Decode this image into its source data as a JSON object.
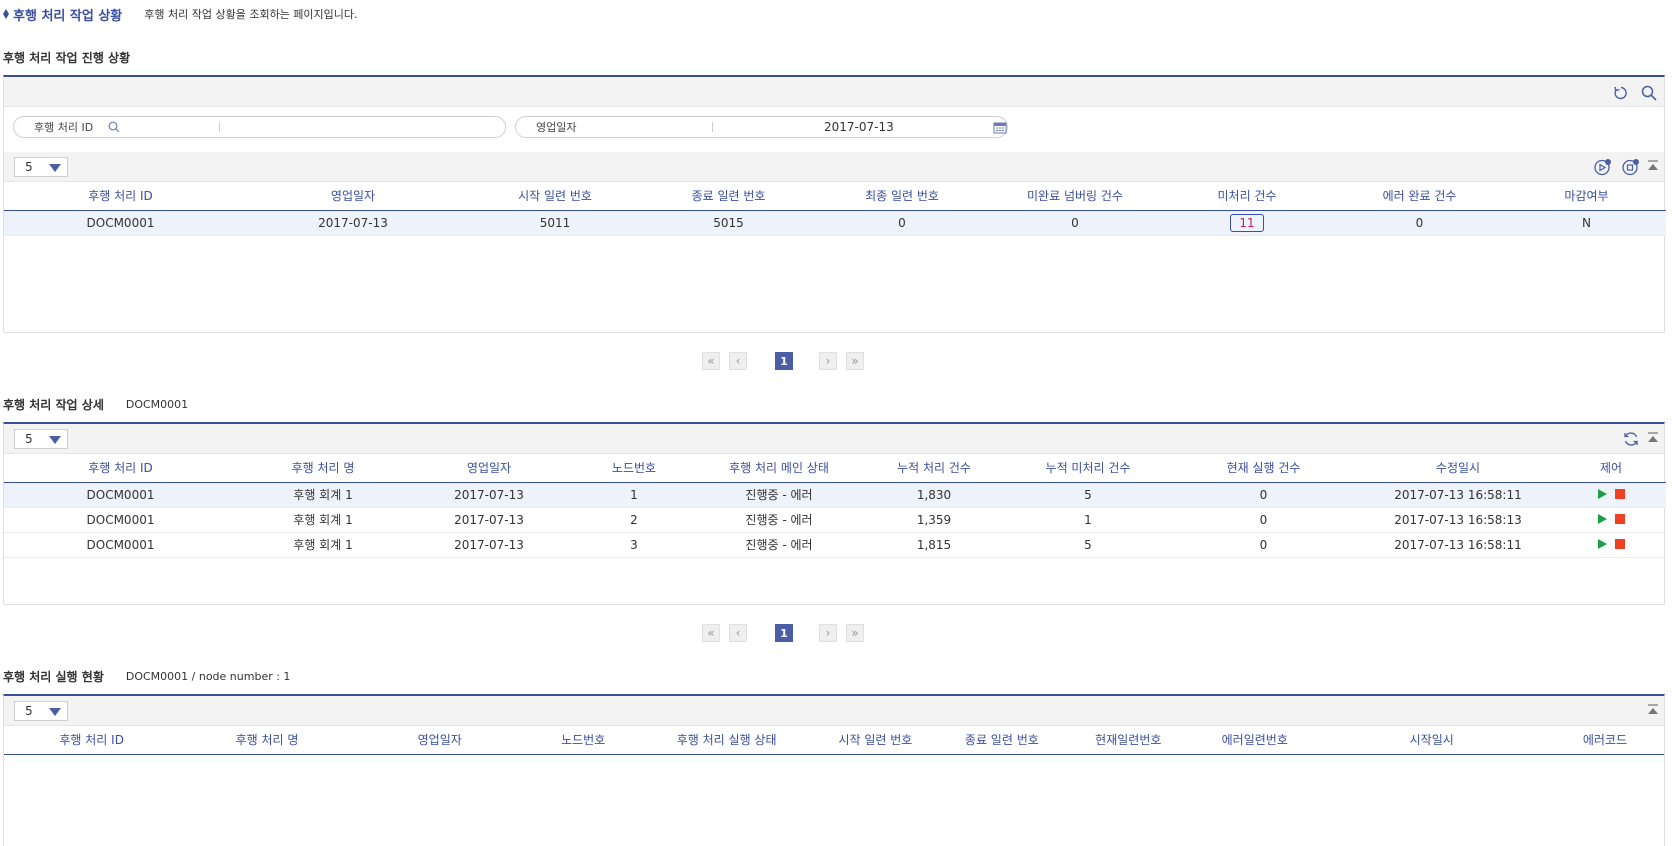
{
  "page": {
    "title": "후행 처리 작업 상황",
    "description": "후행 처리 작업 상황을 조회하는 페이지입니다."
  },
  "section1": {
    "title": "후행 처리 작업 진행 상황",
    "filters": {
      "id_label": "후행 처리 ID",
      "id_value": "",
      "date_label": "영업일자",
      "date_value": "2017-07-13"
    },
    "page_size": "5",
    "columns": [
      "후행 처리 ID",
      "영업일자",
      "시작 일련 번호",
      "종료 일련 번호",
      "최종 일련 번호",
      "미완료 넘버링 건수",
      "미처리 건수",
      "에러 완료 건수",
      "마감여부"
    ],
    "rows": [
      [
        "DOCM0001",
        "2017-07-13",
        "5011",
        "5015",
        "0",
        "0",
        "11",
        "0",
        "N"
      ]
    ],
    "pager": {
      "first": "«",
      "prev": "‹",
      "current": "1",
      "next": "›",
      "last": "»"
    }
  },
  "section2": {
    "title": "후행 처리 작업 상세",
    "subtitle": "DOCM0001",
    "page_size": "5",
    "columns": [
      "후행 처리 ID",
      "후행 처리 명",
      "영업일자",
      "노드번호",
      "후행 처리 메인 상태",
      "누적 처리 건수",
      "누적 미처리 건수",
      "현재 실행 건수",
      "수정일시",
      "제어"
    ],
    "rows": [
      [
        "DOCM0001",
        "후행 회계 1",
        "2017-07-13",
        "1",
        "진행중 - 에러",
        "1,830",
        "5",
        "0",
        "2017-07-13 16:58:11"
      ],
      [
        "DOCM0001",
        "후행 회계 1",
        "2017-07-13",
        "2",
        "진행중 - 에러",
        "1,359",
        "1",
        "0",
        "2017-07-13 16:58:13"
      ],
      [
        "DOCM0001",
        "후행 회계 1",
        "2017-07-13",
        "3",
        "진행중 - 에러",
        "1,815",
        "5",
        "0",
        "2017-07-13 16:58:11"
      ]
    ],
    "pager": {
      "first": "«",
      "prev": "‹",
      "current": "1",
      "next": "›",
      "last": "»"
    }
  },
  "section3": {
    "title": "후행 처리 실행 현황",
    "subtitle": "DOCM0001 / node number : 1",
    "page_size": "5",
    "columns": [
      "후행 처리 ID",
      "후행 처리 명",
      "영업일자",
      "노드번호",
      "후행 처리 실행 상태",
      "시작 일련 번호",
      "종료 일련 번호",
      "현재일련번호",
      "에러일련번호",
      "시작일시",
      "에러코드"
    ]
  },
  "colors": {
    "accent": "#3a4ea0",
    "play": "#1e9e4a",
    "stop": "#f04022",
    "badge_text": "#c02070"
  }
}
